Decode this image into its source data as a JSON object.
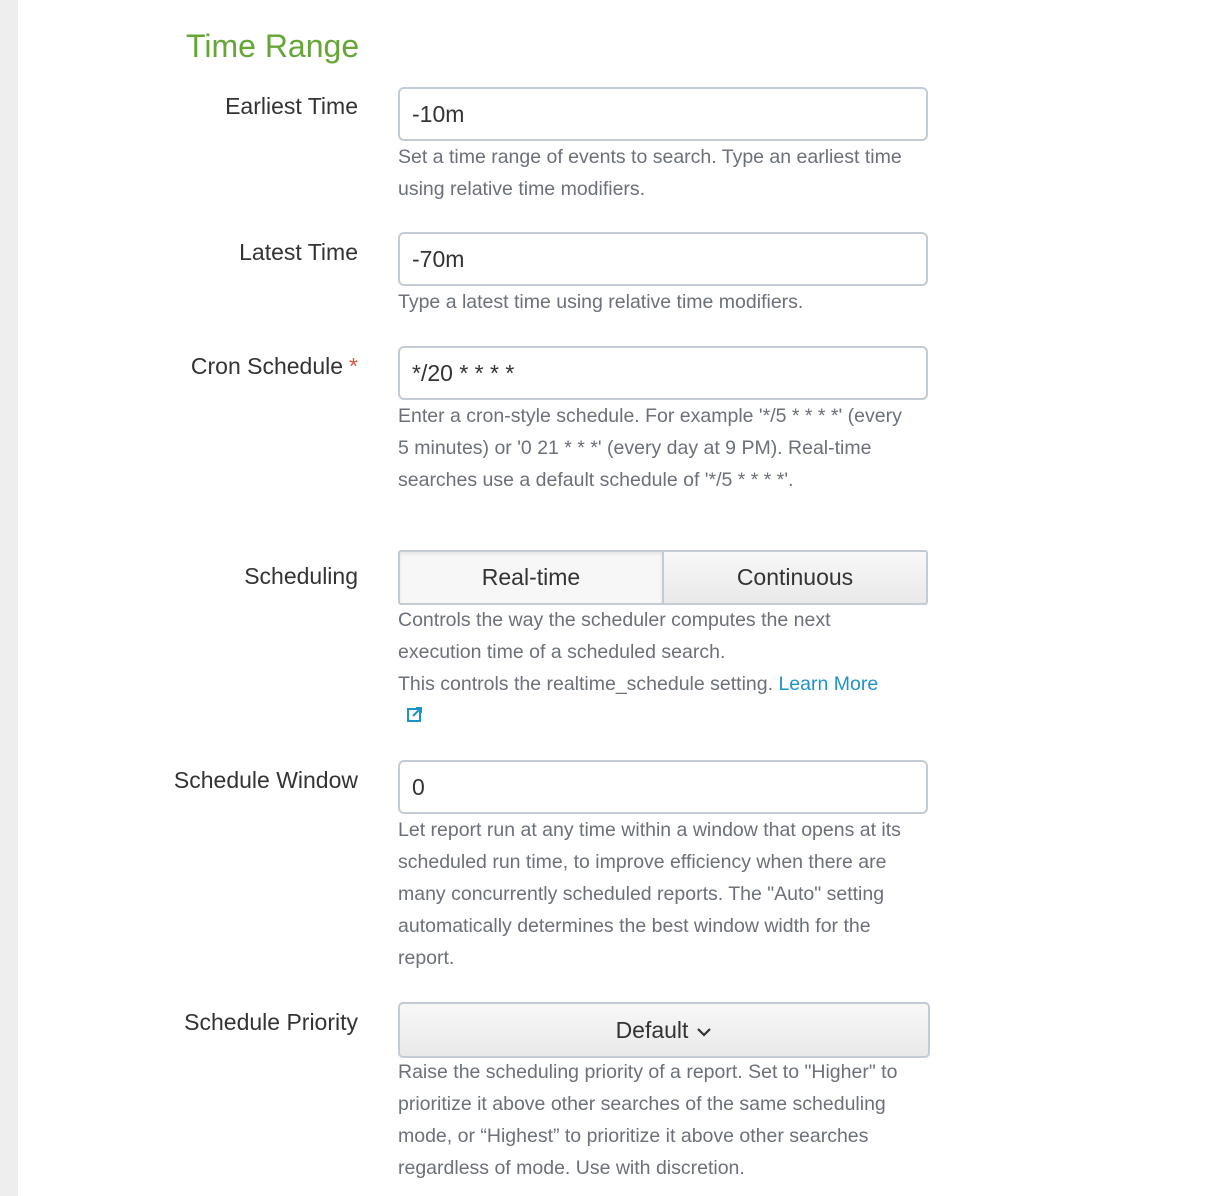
{
  "section": {
    "title": "Time Range"
  },
  "earliest_time": {
    "label": "Earliest Time",
    "value": "-10m",
    "help": "Set a time range of events to search. Type an earliest time using relative time modifiers."
  },
  "latest_time": {
    "label": "Latest Time",
    "value": "-70m",
    "help": "Type a latest time using relative time modifiers."
  },
  "cron_schedule": {
    "label": "Cron Schedule",
    "required_marker": "*",
    "value": "*/20 * * * *",
    "help": "Enter a cron-style schedule. For example '*/5 * * * *' (every 5 minutes) or '0 21 * * *' (every day at 9 PM). Real-time searches use a default schedule of '*/5 * * * *'."
  },
  "scheduling": {
    "label": "Scheduling",
    "options": [
      "Real-time",
      "Continuous"
    ],
    "selected": "Real-time",
    "help_line1": "Controls the way the scheduler computes the next execution time of a scheduled search.",
    "help_line2": "This controls the realtime_schedule setting.",
    "learn_more": "Learn More",
    "link_color": "#1e93c6"
  },
  "schedule_window": {
    "label": "Schedule Window",
    "value": "0",
    "help": "Let report run at any time within a window that opens at its scheduled run time, to improve efficiency when there are many concurrently scheduled reports. The \"Auto\" setting automatically determines the best window width for the report."
  },
  "schedule_priority": {
    "label": "Schedule Priority",
    "selected": "Default",
    "help": "Raise the scheduling priority of a report. Set to \"Higher\" to prioritize it above other searches of the same scheduling mode, or “Highest” to prioritize it above other searches regardless of mode. Use with discretion."
  },
  "colors": {
    "title_green": "#65a637",
    "required_red": "#d6563c",
    "help_text": "#6b7079",
    "border": "#c3cbd4"
  }
}
